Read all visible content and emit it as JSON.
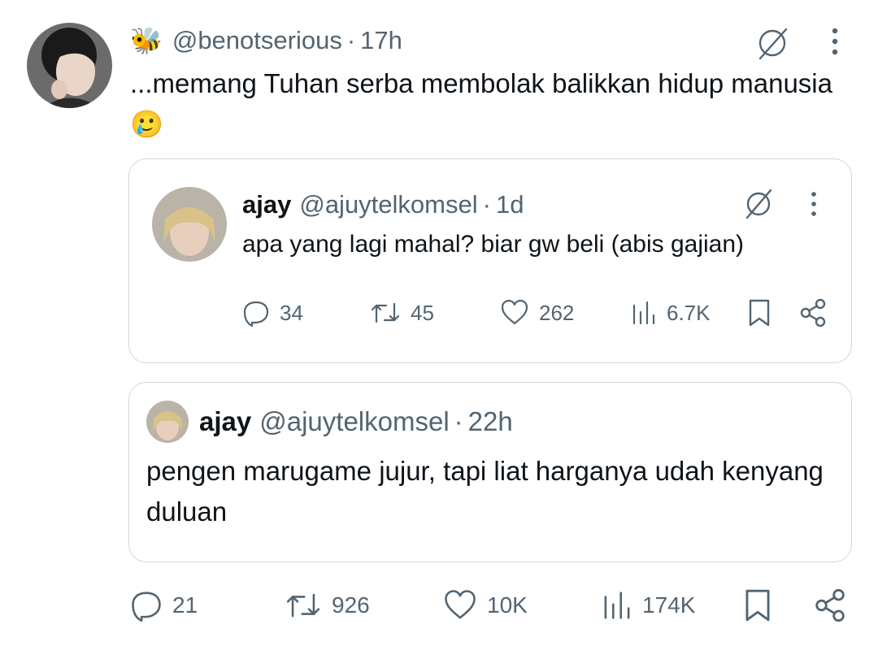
{
  "main_tweet": {
    "handle": "@benotserious",
    "time": "17h",
    "text": "...memang Tuhan serba membolak balikkan hidup manusia",
    "emoji": "🥲",
    "badge_emoji": "🐝",
    "stats": {
      "replies": "21",
      "reposts": "926",
      "likes": "10K",
      "views": "174K"
    }
  },
  "quoted_tweet_1": {
    "name": "ajay",
    "handle": "@ajuytelkomsel",
    "time": "1d",
    "text": "apa yang lagi mahal? biar gw beli (abis gajian)",
    "stats": {
      "replies": "34",
      "reposts": "45",
      "likes": "262",
      "views": "6.7K"
    }
  },
  "quoted_tweet_2": {
    "name": "ajay",
    "handle": "@ajuytelkomsel",
    "time": "22h",
    "text": "pengen marugame jujur, tapi liat harganya udah kenyang duluan"
  },
  "separator": "·",
  "icons": [
    "grok-icon",
    "more-icon",
    "reply-icon",
    "repost-icon",
    "like-icon",
    "views-icon",
    "bookmark-icon",
    "share-icon"
  ],
  "colors": {
    "text": "#0f1419",
    "secondary": "#536471",
    "border": "#cfd9de"
  }
}
